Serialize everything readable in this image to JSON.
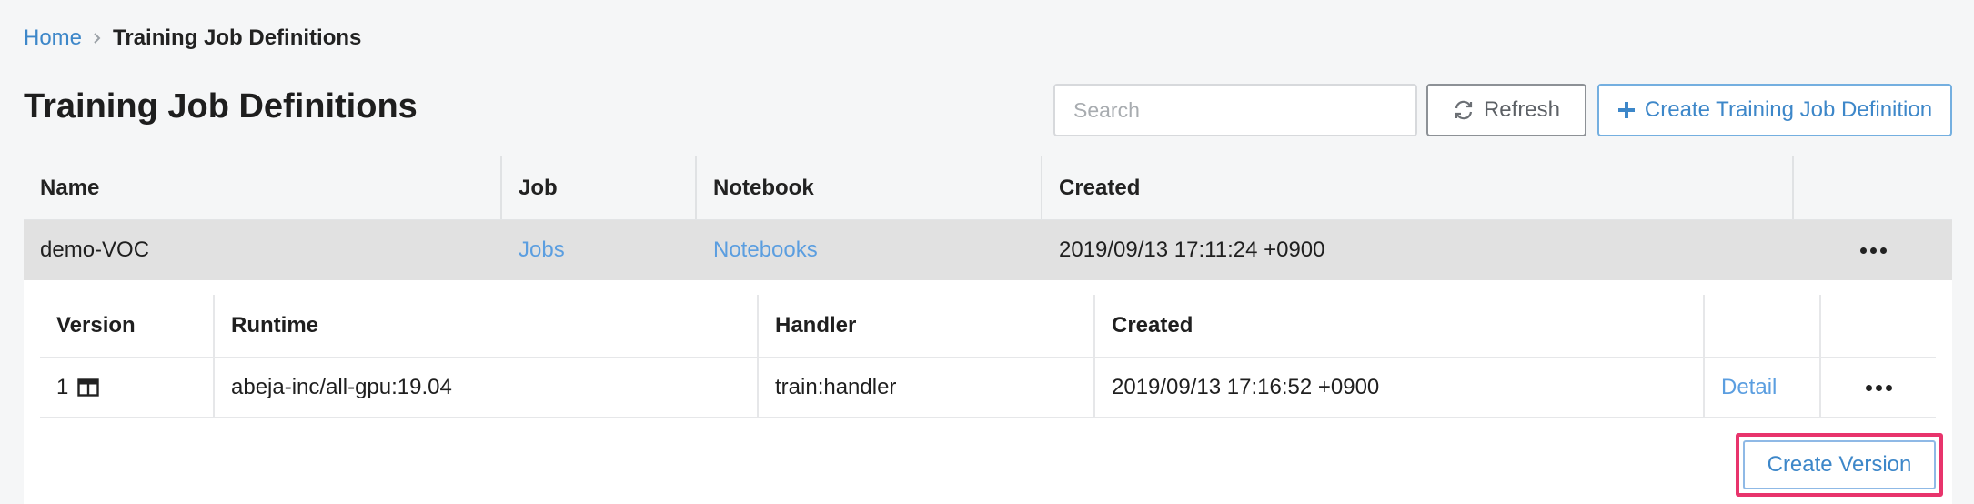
{
  "breadcrumb": {
    "home": "Home",
    "current": "Training Job Definitions"
  },
  "page": {
    "title": "Training Job Definitions"
  },
  "toolbar": {
    "search_placeholder": "Search",
    "refresh_label": "Refresh",
    "create_definition_label": "Create Training Job Definition"
  },
  "table": {
    "headers": [
      "Name",
      "Job",
      "Notebook",
      "Created"
    ],
    "rows": [
      {
        "name": "demo-VOC",
        "job_link": "Jobs",
        "notebook_link": "Notebooks",
        "created": "2019/09/13 17:11:24 +0900"
      }
    ]
  },
  "versions": {
    "headers": [
      "Version",
      "Runtime",
      "Handler",
      "Created"
    ],
    "rows": [
      {
        "version": "1",
        "runtime": "abeja-inc/all-gpu:19.04",
        "handler": "train:handler",
        "created": "2019/09/13 17:16:52 +0900",
        "detail_link": "Detail"
      }
    ],
    "create_version_label": "Create Version"
  },
  "colors": {
    "accent": "#3d87c9",
    "link": "#5b9ee0",
    "highlight": "#e8346c",
    "row_selected": "#e1e1e1"
  }
}
